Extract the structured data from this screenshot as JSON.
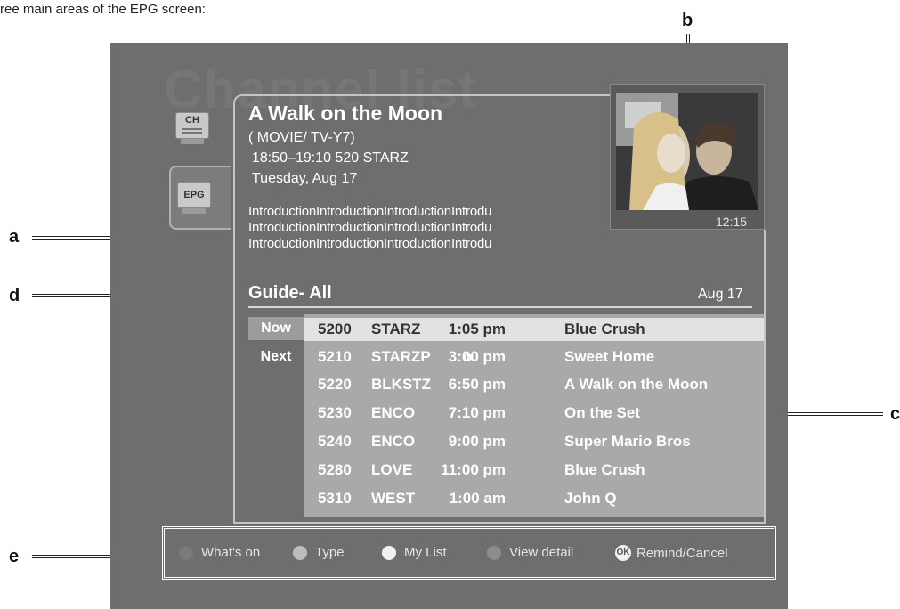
{
  "caption": "ree main areas of the EPG screen:",
  "watermark": "Channel list",
  "side_tabs": {
    "ch": "CH",
    "epg": "EPG"
  },
  "program": {
    "title": "A Walk on the Moon",
    "category": "( MOVIE/ TV-Y7)",
    "time_channel": "18:50–19:10  520 STARZ",
    "date": "Tuesday, Aug 17",
    "introduction": [
      "IntroductionIntroductionIntroductionIntrodu",
      "IntroductionIntroductionIntroductionIntrodu",
      "IntroductionIntroductionIntroductionIntrodu"
    ]
  },
  "preview": {
    "time": "12:15"
  },
  "guide": {
    "title": "Guide- All",
    "date": "Aug 17",
    "now_label": "Now",
    "next_label": "Next",
    "rows": [
      {
        "num": "5200",
        "channel": "STARZ",
        "time": "1:05 pm",
        "title": "Blue Crush",
        "selected": true,
        "reminder": false
      },
      {
        "num": "5210",
        "channel": "STARZP",
        "time": "3:00 pm",
        "title": "Sweet Home",
        "selected": false,
        "reminder": true
      },
      {
        "num": "5220",
        "channel": "BLKSTZ",
        "time": "6:50 pm",
        "title": "A Walk on the Moon",
        "selected": false,
        "reminder": false
      },
      {
        "num": "5230",
        "channel": "ENCO",
        "time": "7:10 pm",
        "title": "On the Set",
        "selected": false,
        "reminder": false
      },
      {
        "num": "5240",
        "channel": "ENCO",
        "time": "9:00 pm",
        "title": "Super Mario Bros",
        "selected": false,
        "reminder": false
      },
      {
        "num": "5280",
        "channel": "LOVE",
        "time": "11:00 pm",
        "title": "Blue Crush",
        "selected": false,
        "reminder": false
      },
      {
        "num": "5310",
        "channel": "WEST",
        "time": "1:00 am",
        "title": "John Q",
        "selected": false,
        "reminder": false
      }
    ]
  },
  "footer": {
    "items": [
      {
        "label": "What's on",
        "color": "#7a7a7a"
      },
      {
        "label": "Type",
        "color": "#bdbdbd"
      },
      {
        "label": "My List",
        "color": "#f2f2f2"
      },
      {
        "label": "View detail",
        "color": "#8c8c8c"
      }
    ],
    "ok_badge": "OK",
    "ok_label": "Remind/Cancel"
  },
  "annotations": {
    "a": "a",
    "b": "b",
    "c": "c",
    "d": "d",
    "e": "e"
  }
}
